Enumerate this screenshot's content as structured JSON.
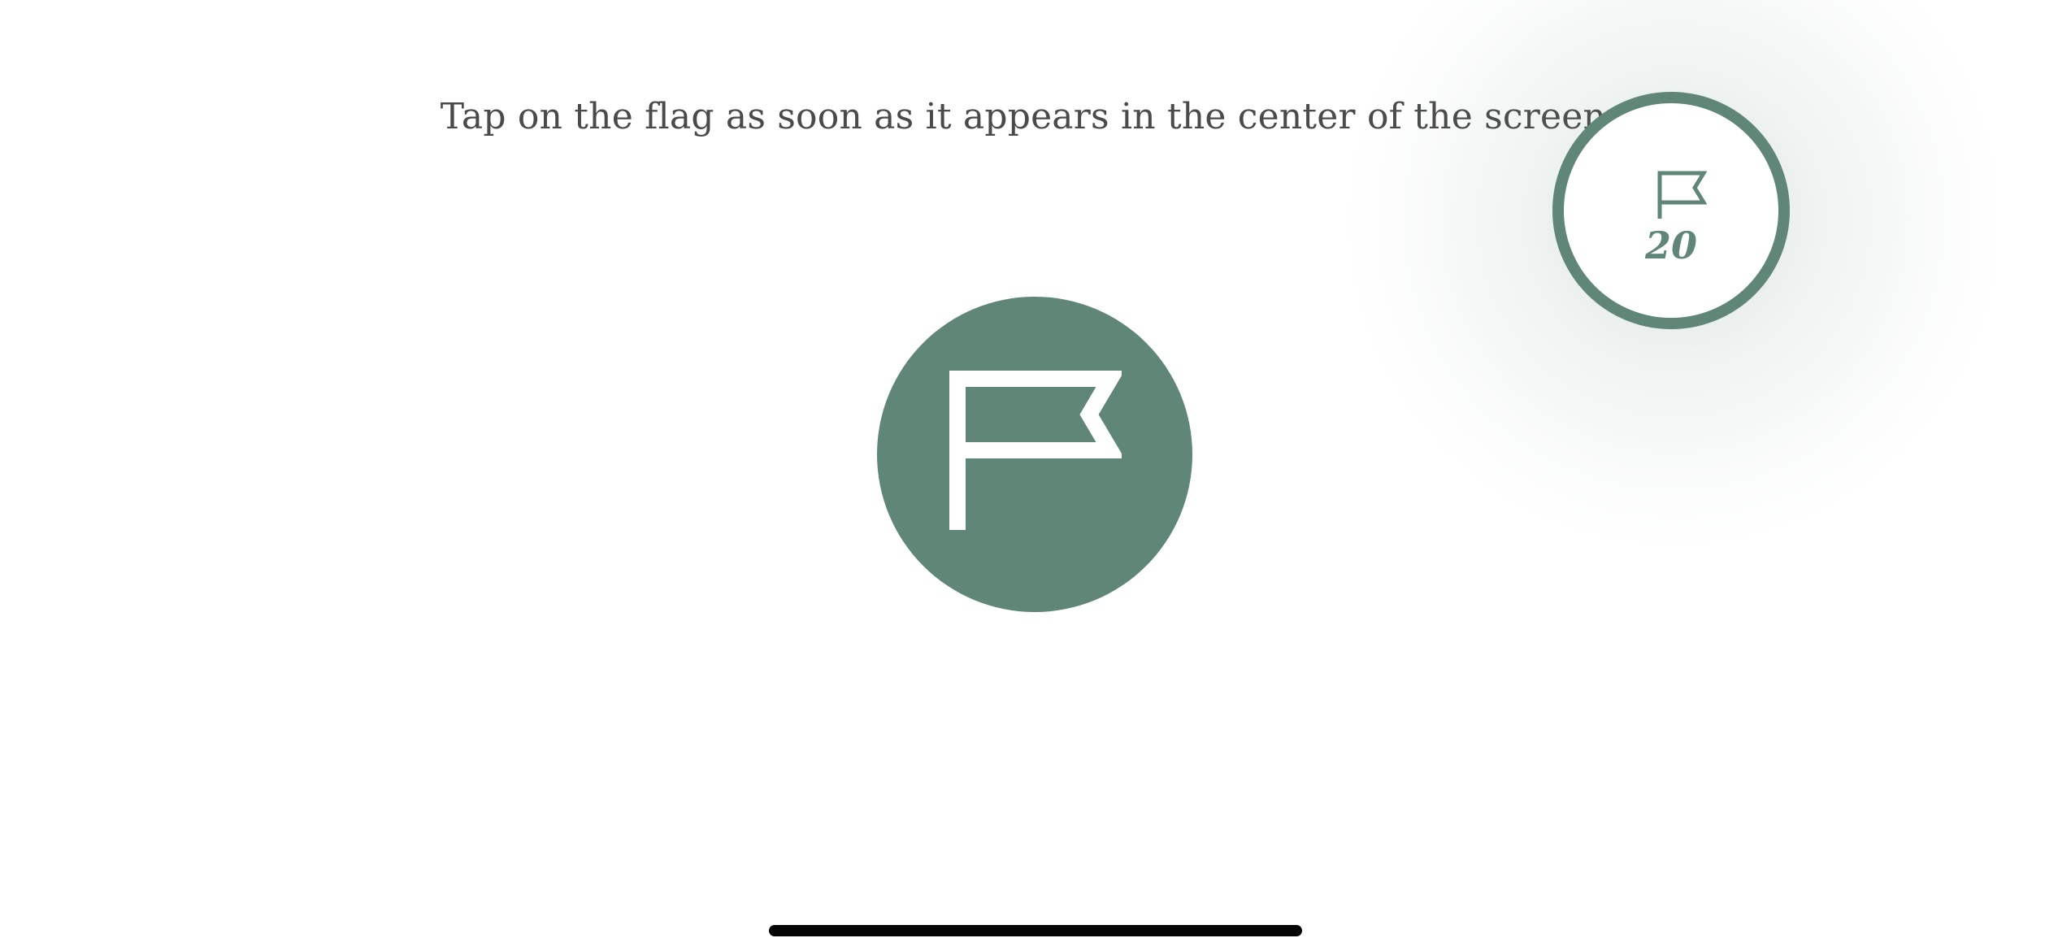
{
  "instruction": "Tap on the flag as soon as it appears in the center of the screen.",
  "counter": {
    "icon": "flag-icon",
    "value": "20"
  },
  "target": {
    "icon": "flag-icon"
  },
  "colors": {
    "accent": "#5f8676",
    "text": "#4a4a4a",
    "background": "#ffffff",
    "home_indicator": "#050505"
  }
}
